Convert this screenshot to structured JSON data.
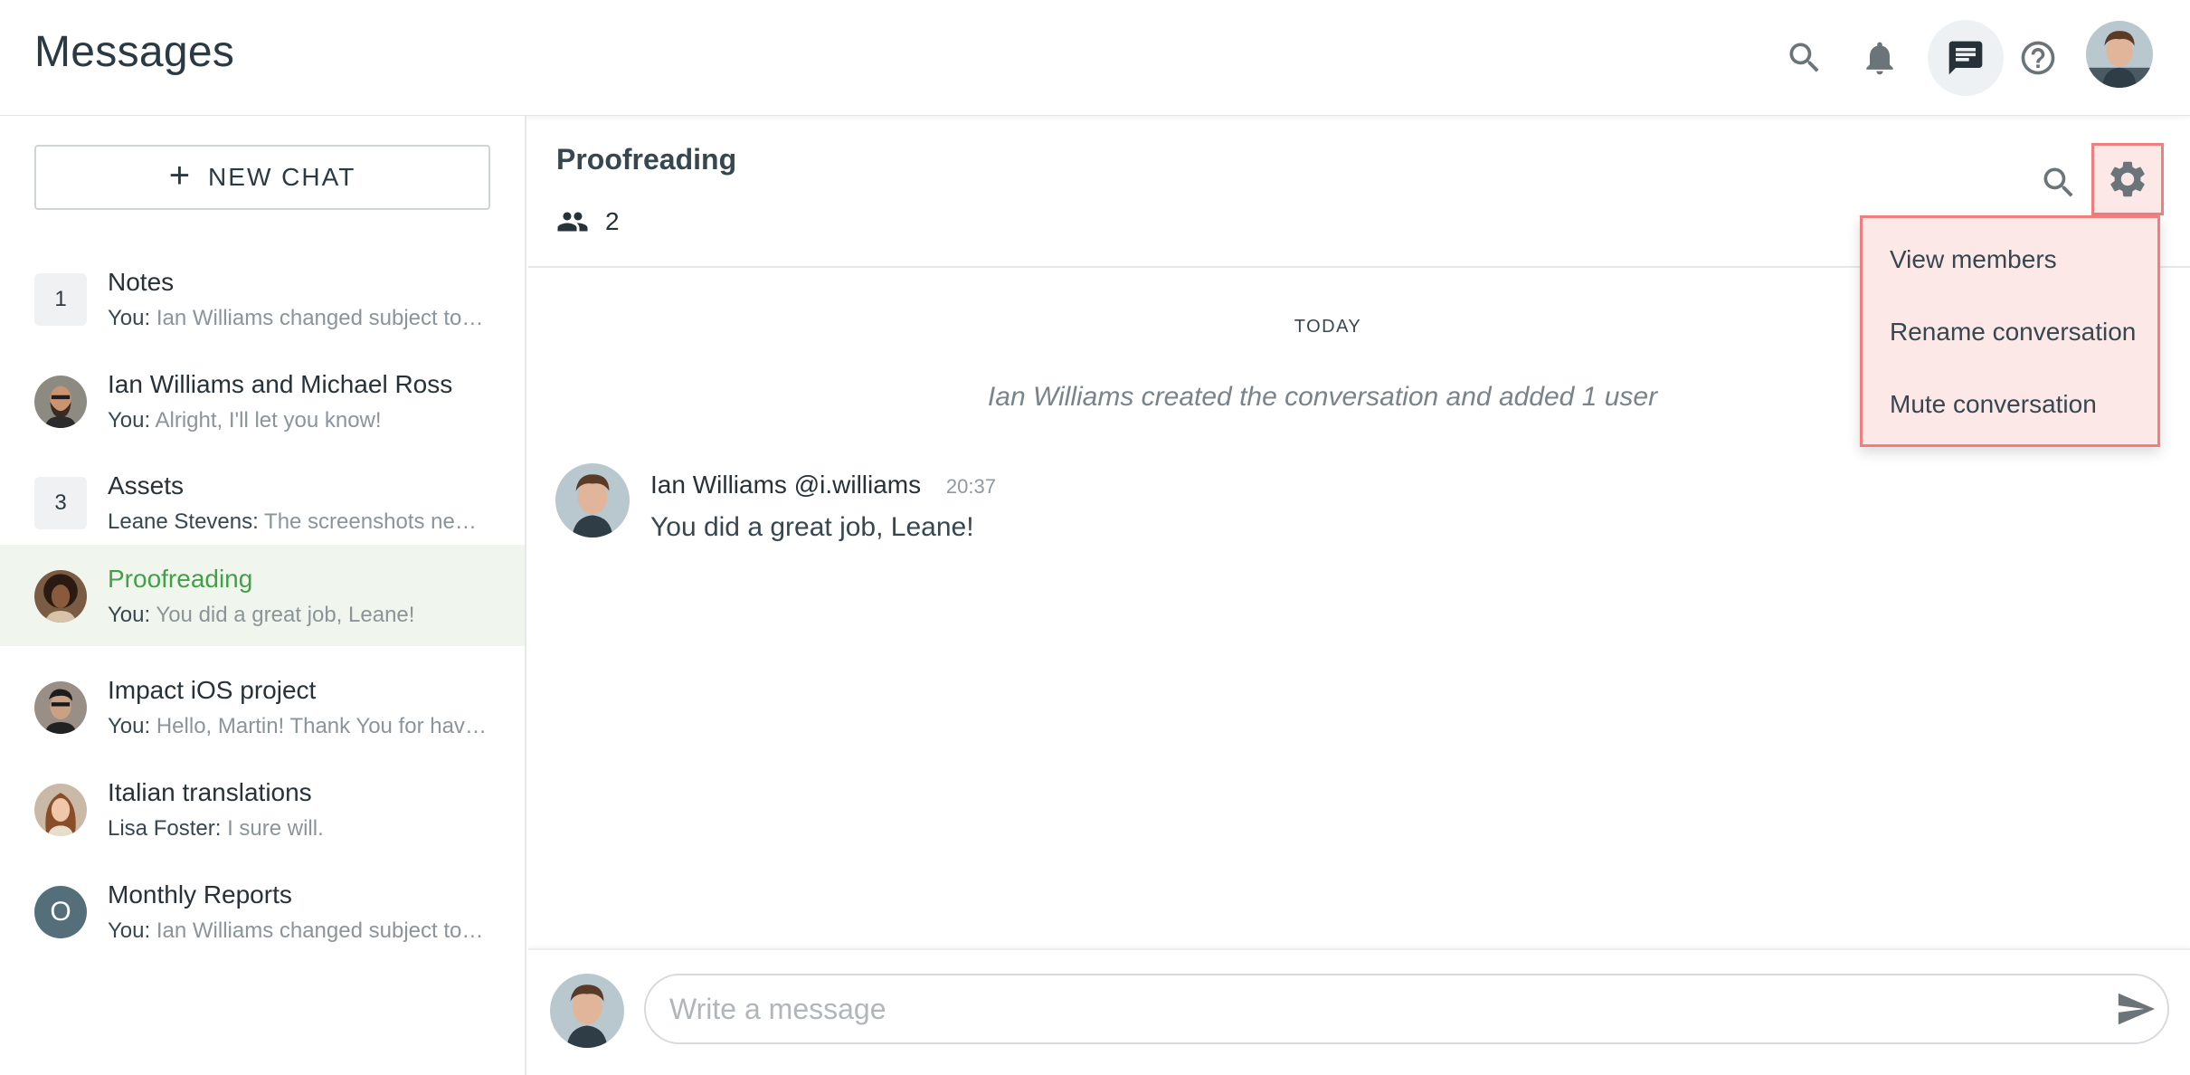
{
  "app": {
    "title": "Messages"
  },
  "topbar": {
    "icons": [
      "search-icon",
      "bell-icon",
      "chat-icon",
      "help-icon"
    ],
    "active_icon": "chat-icon"
  },
  "sidebar": {
    "new_chat_label": "NEW CHAT",
    "conversations": [
      {
        "title": "Notes",
        "badge": "1",
        "sender": "You:",
        "preview": "Ian Williams changed subject to Notes",
        "selected": false
      },
      {
        "title": "Ian Williams and Michael Ross",
        "sender": "You:",
        "preview": "Alright, I'll let you know!",
        "selected": false
      },
      {
        "title": "Assets",
        "badge": "3",
        "sender": "Leane Stevens:",
        "preview": "The screenshots need to be updated",
        "selected": false
      },
      {
        "title": "Proofreading",
        "sender": "You:",
        "preview": "You did a great job, Leane!",
        "selected": true
      },
      {
        "title": "Impact iOS project",
        "sender": "You:",
        "preview": "Hello, Martin! Thank You for having me",
        "selected": false
      },
      {
        "title": "Italian translations",
        "sender": "Lisa Foster:",
        "preview": "I sure will.",
        "selected": false
      },
      {
        "title": "Monthly Reports",
        "avatar_letter": "O",
        "sender": "You:",
        "preview": "Ian Williams changed subject to Monthly Reports",
        "selected": false
      }
    ]
  },
  "chat": {
    "title": "Proofreading",
    "member_count": "2",
    "date_separator": "TODAY",
    "system_message": "Ian Williams created the conversation and added 1 user",
    "messages": [
      {
        "author": "Ian Williams",
        "handle": "@i.williams",
        "time": "20:37",
        "text": "You did a great job, Leane!"
      }
    ]
  },
  "settings_menu": {
    "items": [
      "View members",
      "Rename conversation",
      "Mute conversation"
    ]
  },
  "composer": {
    "placeholder": "Write a message",
    "value": ""
  },
  "colors": {
    "accent_green": "#43a047",
    "highlight_border": "#ef7f7f",
    "highlight_fill": "#fde8e8",
    "selected_row": "#f0f6ee"
  }
}
